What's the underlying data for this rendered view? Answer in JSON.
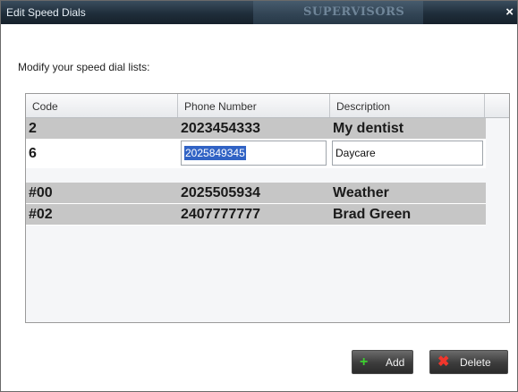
{
  "window": {
    "title": "Edit Speed Dials",
    "background_label": "SUPERVISORS",
    "close_glyph": "×"
  },
  "instructions": "Modify your speed dial lists:",
  "table": {
    "columns": [
      "Code",
      "Phone Number",
      "Description"
    ],
    "rows": [
      {
        "code": "2",
        "phone": "2023454333",
        "description": "My dentist"
      },
      {
        "code": "6",
        "phone": "2025849345",
        "description": "Daycare",
        "editing": true
      },
      {
        "code": "#00",
        "phone": "2025505934",
        "description": "Weather"
      },
      {
        "code": "#02",
        "phone": "2407777777",
        "description": "Brad Green"
      }
    ]
  },
  "buttons": {
    "add_label": "Add",
    "delete_label": "Delete"
  },
  "icons": {
    "add": "plus-icon",
    "delete": "x-icon"
  },
  "colors": {
    "titlebar": "#1f2d3a",
    "row_gray": "#c6c6c6",
    "selection": "#3163c5",
    "add_green": "#35c02a",
    "delete_red": "#e0261f"
  }
}
